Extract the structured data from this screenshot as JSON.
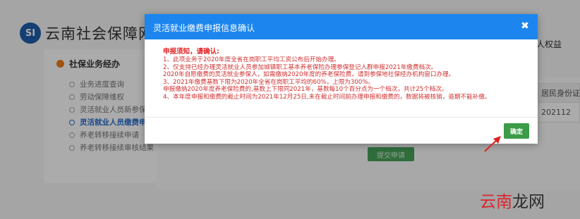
{
  "portal": {
    "logo_text": "SI",
    "title": "云南社会保障网上",
    "right_link": "人权益"
  },
  "sidebar": {
    "header": "社保业务经办",
    "items": [
      {
        "label": "业务进度查询",
        "active": false
      },
      {
        "label": "劳动保障维权",
        "active": false
      },
      {
        "label": "灵活就业人员新参保",
        "active": false
      },
      {
        "label": "灵活就业人员缴费申报",
        "active": true
      },
      {
        "label": "养老转移接续申请",
        "active": false
      },
      {
        "label": "养老转移接续审核结果",
        "active": false
      }
    ]
  },
  "table": {
    "header": "居民身份证",
    "cell": "202112"
  },
  "background_submit_label": "提交申请",
  "modal": {
    "title": "灵活就业缴费申报信息确认",
    "notice_title": "申报须知，请确认:",
    "notice_lines": [
      "1、此项业务于2020年度全省在岗职工平均工资公布后开始办理。",
      "2、仅支持已经办理灵活就业人员参加城镇职工基本养老保险办理参保登记人群申报2021年缴费档次。",
      "2020年自愿缴费的灵活就业参保人，如需缴纳2020年度的养老保险费，请到参保地社保经办机构窗口办理。",
      "3、2021年缴费基数下限为2020年全省在岗职工平均的60%，上限为300%。",
      "申报缴纳2020年度养老保险费的,基数上下限同2021年，基数每10个百分点为一个档次，共计25个档次。",
      "4、本年度申报和缴费的截止时间为2021年12月25日,未在截止时间前办理申报和缴费的，数据将被核销，逾期不能补缴。"
    ],
    "confirm_label": "确定"
  },
  "watermark": {
    "part1": "云南",
    "part2": "龙网"
  },
  "colors": {
    "modal_header": "#1c86ee",
    "notice_text": "#d23030",
    "confirm_button": "#3c9c48",
    "arrow": "#e02020"
  }
}
